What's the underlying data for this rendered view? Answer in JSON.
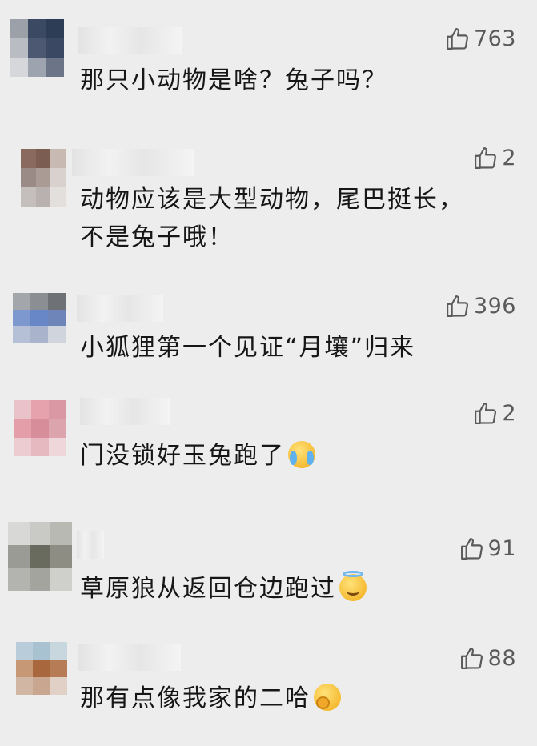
{
  "colors": {
    "background": "#ededed",
    "text": "#161616",
    "meta": "#5a5a5a"
  },
  "comments": [
    {
      "id": 1,
      "likes": "763",
      "text": "那只小动物是啥？兔子吗？",
      "emoji": "",
      "avatar_colors": [
        "#9ca0a8",
        "#3b4a62",
        "#2e3d56",
        "#b9bcc2",
        "#4c5872",
        "#3a4863",
        "#d6d7da",
        "#9ea4af",
        "#6c7488"
      ]
    },
    {
      "id": 2,
      "likes": "2",
      "text": "动物应该是大型动物，尾巴挺长，不是兔子哦！",
      "emoji": "",
      "avatar_colors": [
        "#8a6a5e",
        "#7c5d52",
        "#c9b9b3",
        "#9a8b86",
        "#aa9b95",
        "#d9d1ce",
        "#c4bebd",
        "#b8b1b0",
        "#e3dfdd"
      ]
    },
    {
      "id": 3,
      "likes": "396",
      "text": "小狐狸第一个见证“月壤”归来",
      "emoji": "",
      "avatar_colors": [
        "#a3a6ab",
        "#8b8e93",
        "#6e7176",
        "#7d97cf",
        "#6787c7",
        "#6d85b8",
        "#b5bfd6",
        "#a9b4cc",
        "#cfd4dd"
      ]
    },
    {
      "id": 4,
      "likes": "2",
      "text": "门没锁好玉兔跑了",
      "emoji": "cry",
      "avatar_colors": [
        "#e9c3c9",
        "#e7a3ad",
        "#d998a3",
        "#e39ea9",
        "#d88e9a",
        "#dca5ae",
        "#ecccd1",
        "#e6b8bf",
        "#efd6da"
      ]
    },
    {
      "id": 5,
      "likes": "91",
      "text": "草原狼从返回仓边跑过",
      "emoji": "halo",
      "avatar_colors": [
        "#d8d8d6",
        "#c9c9c5",
        "#b9b9b3",
        "#9b9b95",
        "#6a6b5f",
        "#8d8d84",
        "#b3b3af",
        "#a4a49f",
        "#cfcfcc"
      ]
    },
    {
      "id": 6,
      "likes": "88",
      "text": "那有点像我家的二哈",
      "emoji": "smirk",
      "avatar_colors": [
        "#b8cdd9",
        "#a9c2d2",
        "#c8d6de",
        "#c79876",
        "#a9673d",
        "#b67c55",
        "#d2b6a4",
        "#c8a68f",
        "#e0d0c5"
      ]
    }
  ]
}
